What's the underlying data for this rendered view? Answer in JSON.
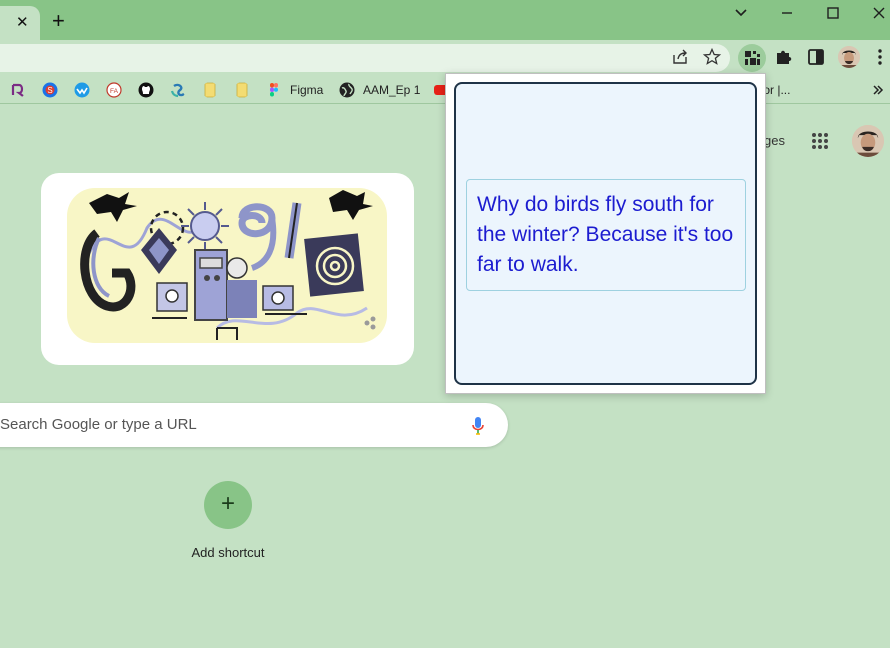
{
  "tab": {
    "close_label": "✕"
  },
  "new_tab_label": "+",
  "bookmarks": [
    {
      "name": "bookmark-1",
      "label": "",
      "color": "#7b2b84"
    },
    {
      "name": "bookmark-2",
      "label": "",
      "color": "#1a73e8"
    },
    {
      "name": "bookmark-3",
      "label": "",
      "color": "#1f9be6"
    },
    {
      "name": "bookmark-4",
      "label": "",
      "color": "#c0392b"
    },
    {
      "name": "bookmark-github",
      "label": "",
      "color": "#111111"
    },
    {
      "name": "bookmark-6",
      "label": "",
      "color": "#2a7ab5"
    },
    {
      "name": "bookmark-folder-1",
      "label": "",
      "color": "#f3dc72"
    },
    {
      "name": "bookmark-folder-2",
      "label": "",
      "color": "#f3dc72"
    },
    {
      "name": "bookmark-figma",
      "label": "Figma",
      "color": "#a259ff"
    },
    {
      "name": "bookmark-aam",
      "label": "AAM_Ep 1",
      "color": "#222222"
    },
    {
      "name": "bookmark-youtube",
      "label": "",
      "color": "#e62117"
    }
  ],
  "bookmark_overflow_label": "tor |...",
  "images_label": "ges",
  "search": {
    "placeholder": "Search Google or type a URL"
  },
  "shortcut": {
    "plus": "+",
    "label": "Add shortcut"
  },
  "popup": {
    "joke": "Why do birds fly south for the winter? Because it's too far to walk."
  },
  "colors": {
    "frame": "#88c487",
    "background": "#c4e1c4",
    "popup_text": "#1c1cd0",
    "popup_border": "#1f3347"
  }
}
